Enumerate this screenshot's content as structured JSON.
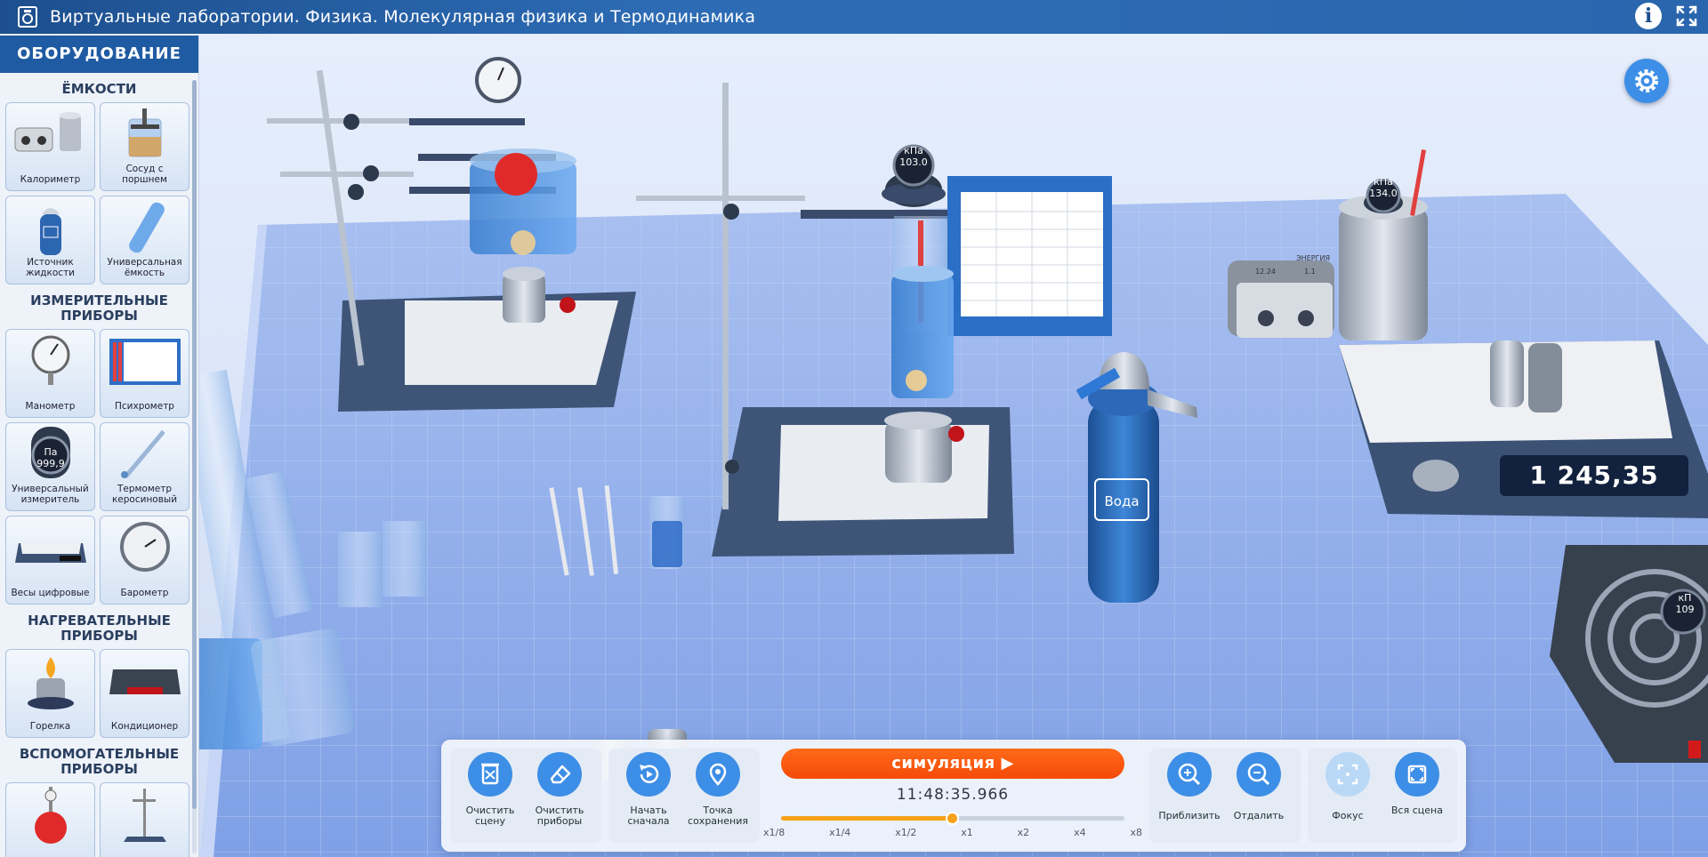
{
  "window": {
    "title": "Виртуальные лаборатории. Физика. Молекулярная физика и Термодинамика",
    "info_label": "i"
  },
  "sidebar": {
    "header": "ОБОРУДОВАНИЕ",
    "sections": [
      {
        "title": "ЁМКОСТИ",
        "items": [
          "Калориметр",
          "Сосуд с поршнем",
          "Источник жидкости",
          "Универсальная ёмкость"
        ]
      },
      {
        "title": "ИЗМЕРИТЕЛЬНЫЕ ПРИБОРЫ",
        "items": [
          "Манометр",
          "Психрометр",
          "Универсальный измеритель",
          "Термометр керосиновый",
          "Весы цифровые",
          "Барометр"
        ]
      },
      {
        "title": "НАГРЕВАТЕЛЬНЫЕ ПРИБОРЫ",
        "items": [
          "Горелка",
          "Кондиционер"
        ]
      },
      {
        "title": "ВСПОМОГАТЕЛЬНЫЕ ПРИБОРЫ",
        "items": [
          "",
          ""
        ]
      }
    ],
    "meter_tile": {
      "unit": "Па",
      "value": "999,9"
    }
  },
  "scene": {
    "gauge1": {
      "unit": "кПа",
      "value": "103.0"
    },
    "gauge2": {
      "unit": "кПа",
      "value": "134.0"
    },
    "gauge3": {
      "unit": "кП",
      "value": "109"
    },
    "scale_value": "1 245,35",
    "water_label": "Вода",
    "power_unit": {
      "brand": "ЭНЕРГИЯ",
      "left_value": "12.24",
      "right_value": "1.1"
    }
  },
  "toolbar": {
    "clear_scene": "Очистить сцену",
    "clear_devices": "Очистить приборы",
    "restart": "Начать сначала",
    "save_point": "Точка сохранения",
    "simulation_label": "симуляция ▶",
    "time": "11:48:35.966",
    "speeds": [
      "x1/8",
      "x1/4",
      "x1/2",
      "x1",
      "x2",
      "x4",
      "x8"
    ],
    "speed_selected_index": 3,
    "zoom_in": "Приблизить",
    "zoom_out": "Отдалить",
    "focus": "Фокус",
    "whole_scene": "Вся сцена"
  },
  "colors": {
    "accent_blue": "#3d8ee6",
    "sim_orange": "#f44a08",
    "slider_orange": "#f7a21a",
    "titlebar": "#1f5ba2"
  }
}
